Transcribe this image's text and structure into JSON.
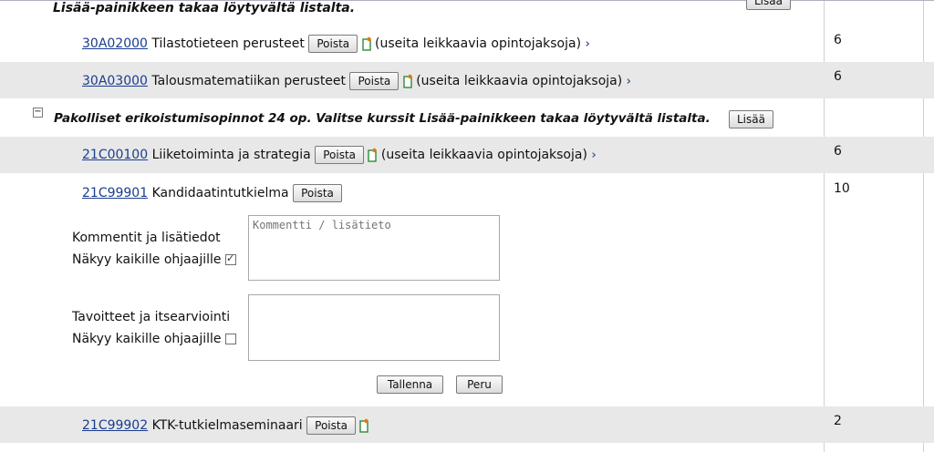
{
  "top_fragment": {
    "text": "Lisää-painikkeen takaa löytyvältä listalta.",
    "button": "Lisää"
  },
  "courses_a": [
    {
      "code": "30A02000",
      "name": "Tilastotieteen perusteet",
      "remove": "Poista",
      "note": "(useita leikkaavia opintojaksoja)",
      "credits": "6"
    },
    {
      "code": "30A03000",
      "name": "Talousmatematiikan perusteet",
      "remove": "Poista",
      "note": "(useita leikkaavia opintojaksoja)",
      "credits": "6"
    }
  ],
  "section": {
    "toggle": "−",
    "title": "Pakolliset erikoistumisopinnot 24 op. Valitse kurssit Lisää-painikkeen takaa löytyvältä listalta.",
    "button": "Lisää"
  },
  "course_c": {
    "code": "21C00100",
    "name": "Liiketoiminta ja strategia",
    "remove": "Poista",
    "note": "(useita leikkaavia opintojaksoja)",
    "credits": "6"
  },
  "course_thesis": {
    "code": "21C99901",
    "name": "Kandidaatintutkielma",
    "remove": "Poista",
    "credits": "10"
  },
  "comments": {
    "label": "Kommentit ja lisätiedot",
    "visible_label": "Näkyy kaikille ohjaajille",
    "placeholder": "Kommentti / lisätieto",
    "visible": true
  },
  "goals": {
    "label": "Tavoitteet ja itsearviointi",
    "visible_label": "Näkyy kaikille ohjaajille",
    "placeholder": "",
    "visible": false
  },
  "actions": {
    "save": "Tallenna",
    "cancel": "Peru"
  },
  "course_seminar": {
    "code": "21C99902",
    "name": "KTK-tutkielmaseminaari",
    "remove": "Poista",
    "credits": "2"
  },
  "colors": {
    "link": "#1a3d8f",
    "row_alt": "#e8e8e8",
    "icon_orange": "#e07a10",
    "icon_green": "#2e8b3a"
  }
}
